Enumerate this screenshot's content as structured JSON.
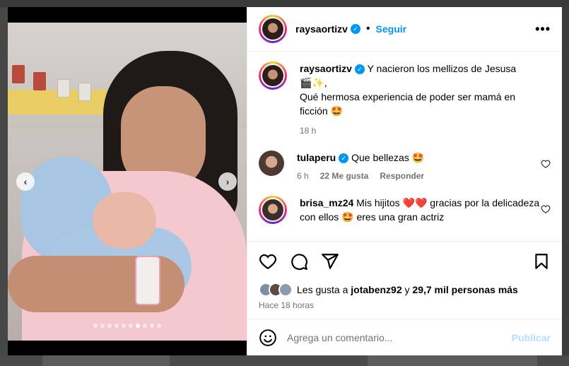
{
  "post": {
    "username": "raysaortizv",
    "follow_label": "Seguir",
    "separator": "•",
    "more_label": "•••"
  },
  "caption": {
    "username": "raysaortizv",
    "line1": "Y nacieron los mellizos de Jesusa",
    "line1_emoji": "🎬✨,",
    "line2": "Qué hermosa experiencia de poder ser mamá en ficción",
    "line2_emoji": "🤩",
    "time": "18 h"
  },
  "comments": [
    {
      "username": "tulaperu",
      "text": "Que bellezas",
      "emoji": "🤩",
      "time": "6 h",
      "likes": "22 Me gusta",
      "reply": "Responder",
      "verified": true
    },
    {
      "username": "brisa_mz24",
      "text": "Mis hijitos ❤️❤️ gracias por la delicadeza con ellos 🤩 eres una gran actriz",
      "verified": false
    }
  ],
  "likes": {
    "prefix": "Les gusta a",
    "user": "jotabenz92",
    "conj": "y",
    "count": "29,7 mil personas más"
  },
  "posted_ago": "Hace 18 horas",
  "add_comment": {
    "placeholder": "Agrega un comentario...",
    "publish": "Publicar"
  },
  "carousel": {
    "total_slides": 10,
    "active_index": 6
  },
  "colors": {
    "accent": "#0095f6",
    "publish_disabled": "#b2dffc",
    "muted": "#737373"
  },
  "icons": [
    "heart-icon",
    "comment-icon",
    "share-icon",
    "bookmark-icon",
    "emoji-icon",
    "more-icon",
    "verified-icon",
    "chevron-left-icon",
    "chevron-right-icon"
  ]
}
